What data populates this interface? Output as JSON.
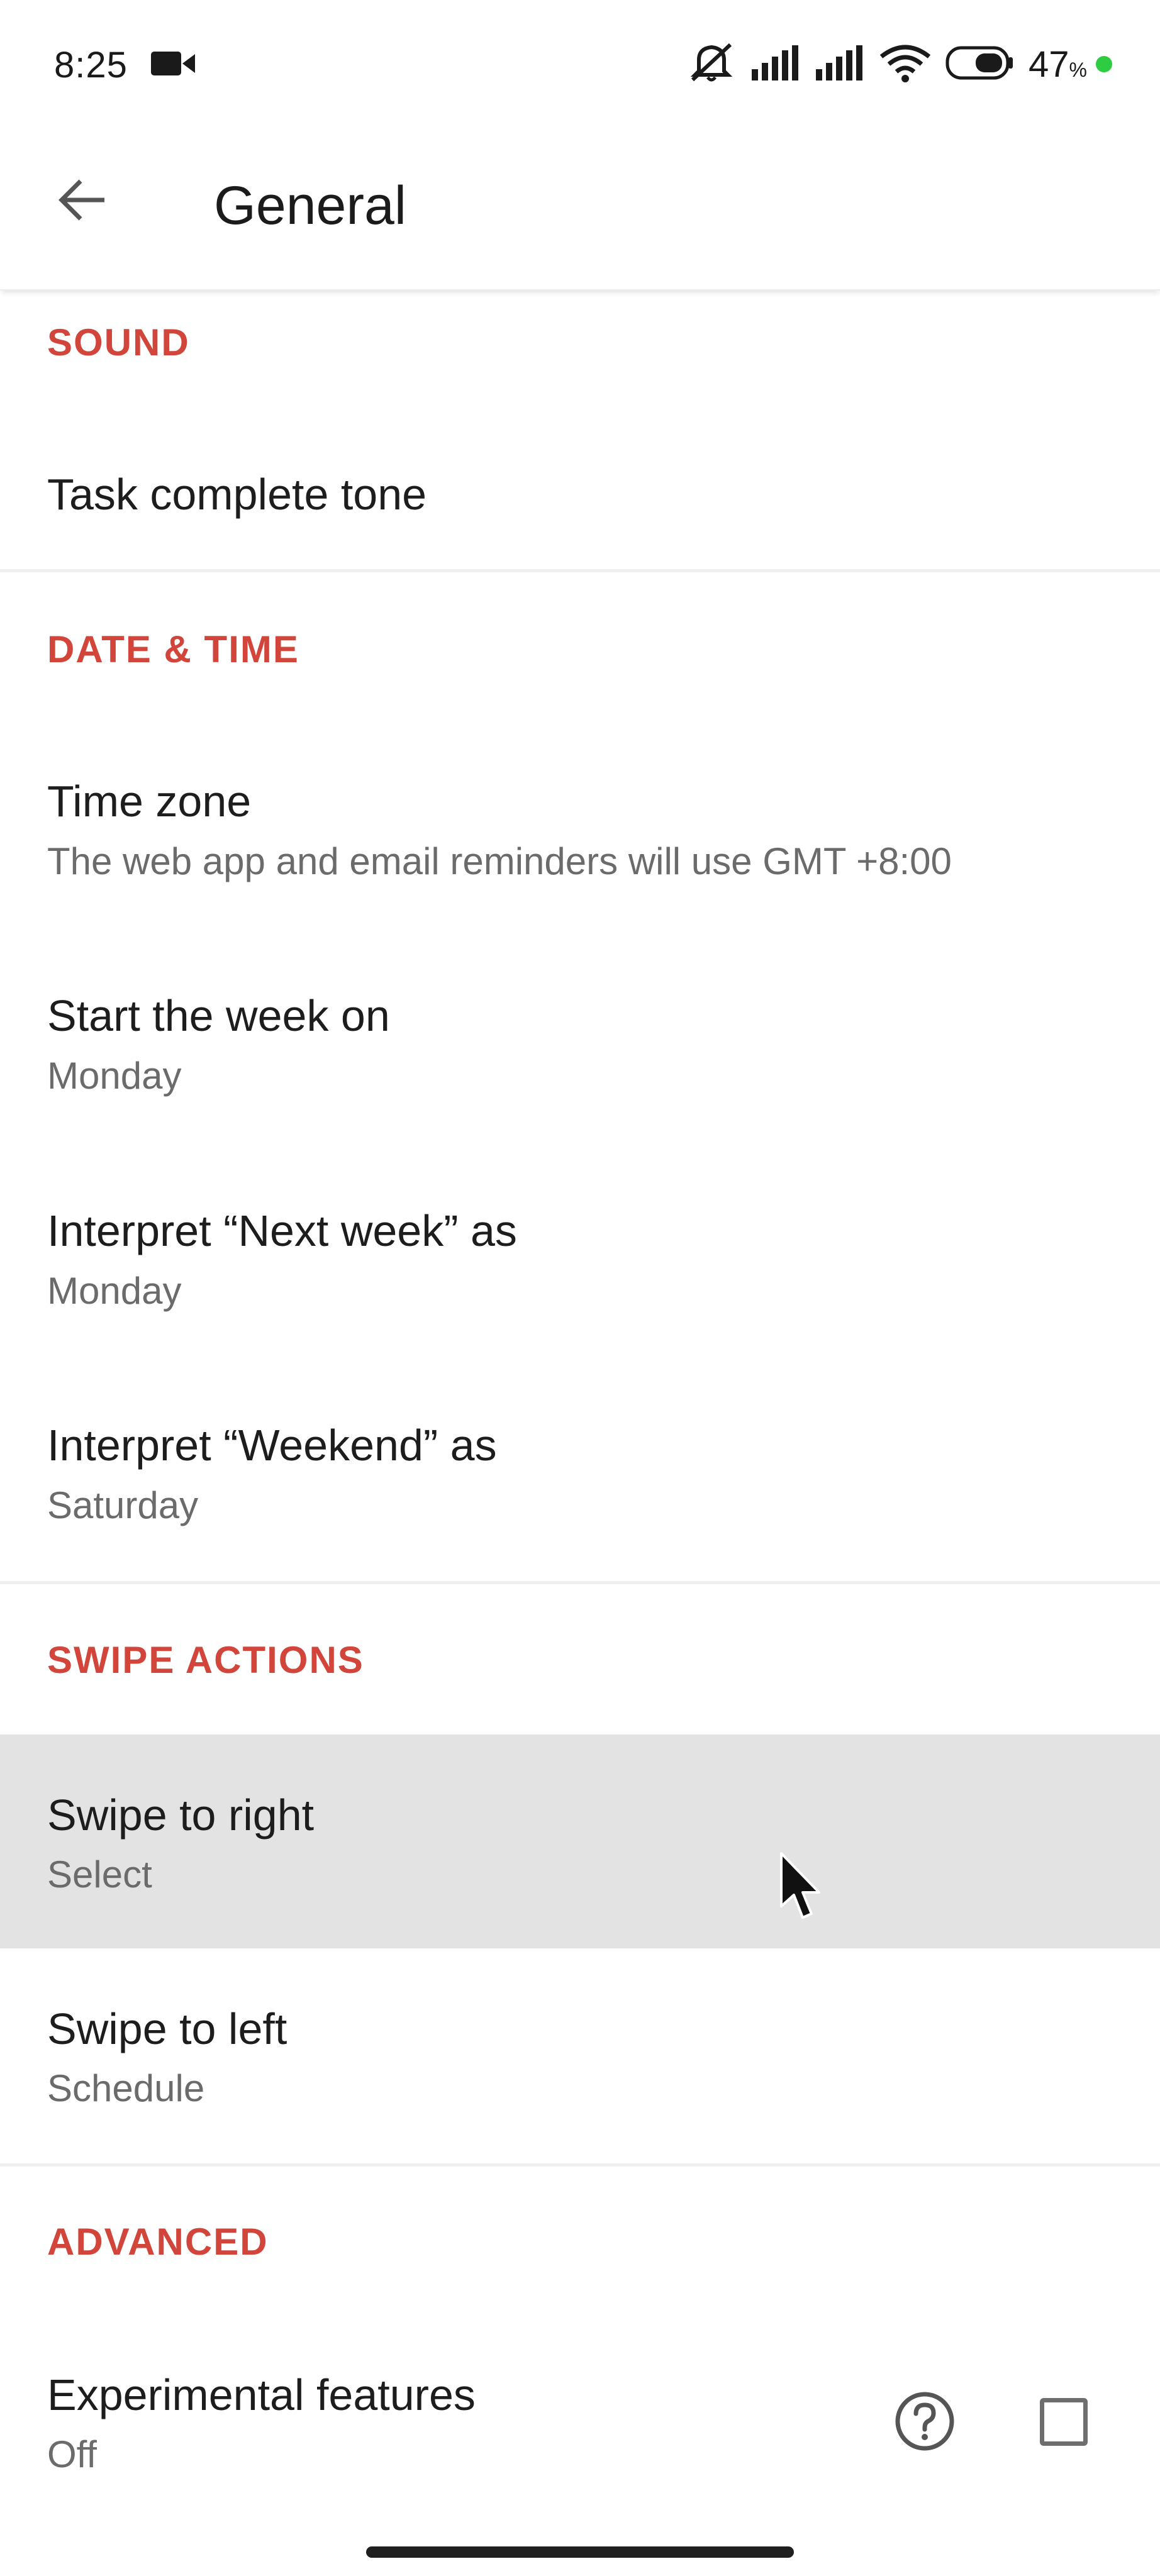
{
  "status_bar": {
    "time": "8:25",
    "battery_percent": "47",
    "battery_unit": "%",
    "icons": [
      "video-camera-icon",
      "mute-icon",
      "signal-icon",
      "signal-icon",
      "wifi-icon",
      "battery-icon"
    ]
  },
  "app_bar": {
    "back_icon": "arrow-left-icon",
    "title": "General"
  },
  "sections": {
    "sound": {
      "header": "SOUND",
      "task_complete_tone": {
        "title": "Task complete tone"
      }
    },
    "date_time": {
      "header": "DATE & TIME",
      "time_zone": {
        "title": "Time zone",
        "value": "The web app and email reminders will use GMT +8:00"
      },
      "start_week": {
        "title": "Start the week on",
        "value": "Monday"
      },
      "next_week": {
        "title": "Interpret “Next week” as",
        "value": "Monday"
      },
      "weekend": {
        "title": "Interpret “Weekend” as",
        "value": "Saturday"
      }
    },
    "swipe_actions": {
      "header": "SWIPE ACTIONS",
      "swipe_right": {
        "title": "Swipe to right",
        "value": "Select"
      },
      "swipe_left": {
        "title": "Swipe to left",
        "value": "Schedule"
      }
    },
    "advanced": {
      "header": "ADVANCED",
      "experimental": {
        "title": "Experimental features",
        "value": "Off",
        "checked": false
      }
    }
  },
  "colors": {
    "accent": "#d1453b",
    "highlight": "#e3e3e3",
    "divider": "#efefef"
  }
}
